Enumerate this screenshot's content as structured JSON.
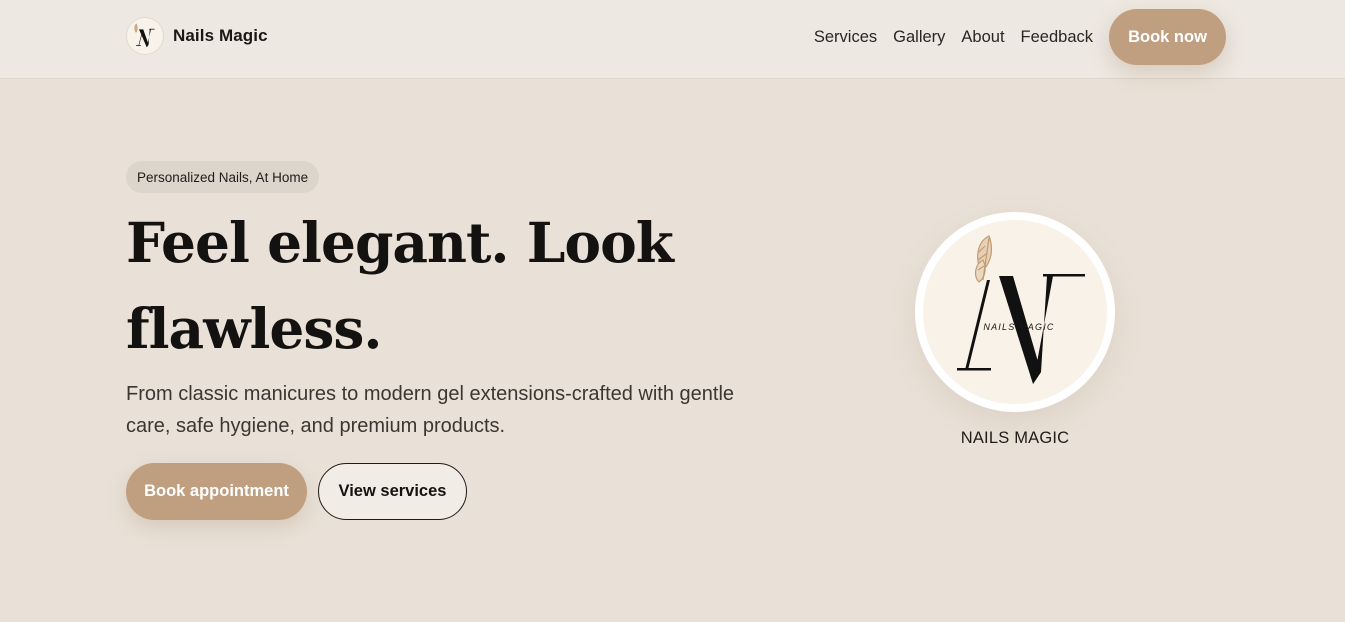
{
  "header": {
    "brand_name": "Nails Magic",
    "nav": [
      "Services",
      "Gallery",
      "About",
      "Feedback"
    ],
    "cta_label": "Book now"
  },
  "hero": {
    "tagline": "Personalized Nails, At Home",
    "title_line1": "Feel elegant. Look",
    "title_line2": "flawless.",
    "subtitle": "From classic manicures to modern gel extensions-crafted with gentle care, safe hygiene, and premium products.",
    "primary_button": "Book appointment",
    "secondary_button": "View services"
  },
  "logo_badge": {
    "caption": "NAILS MAGIC",
    "logo_text": "NAILS MAGIC"
  },
  "colors": {
    "background": "#e9e1d7",
    "header_background": "#ede8e1",
    "accent": "#bf9f80",
    "text": "#141210"
  },
  "icons": [
    "nails-magic-logo",
    "butterfly-icon"
  ]
}
